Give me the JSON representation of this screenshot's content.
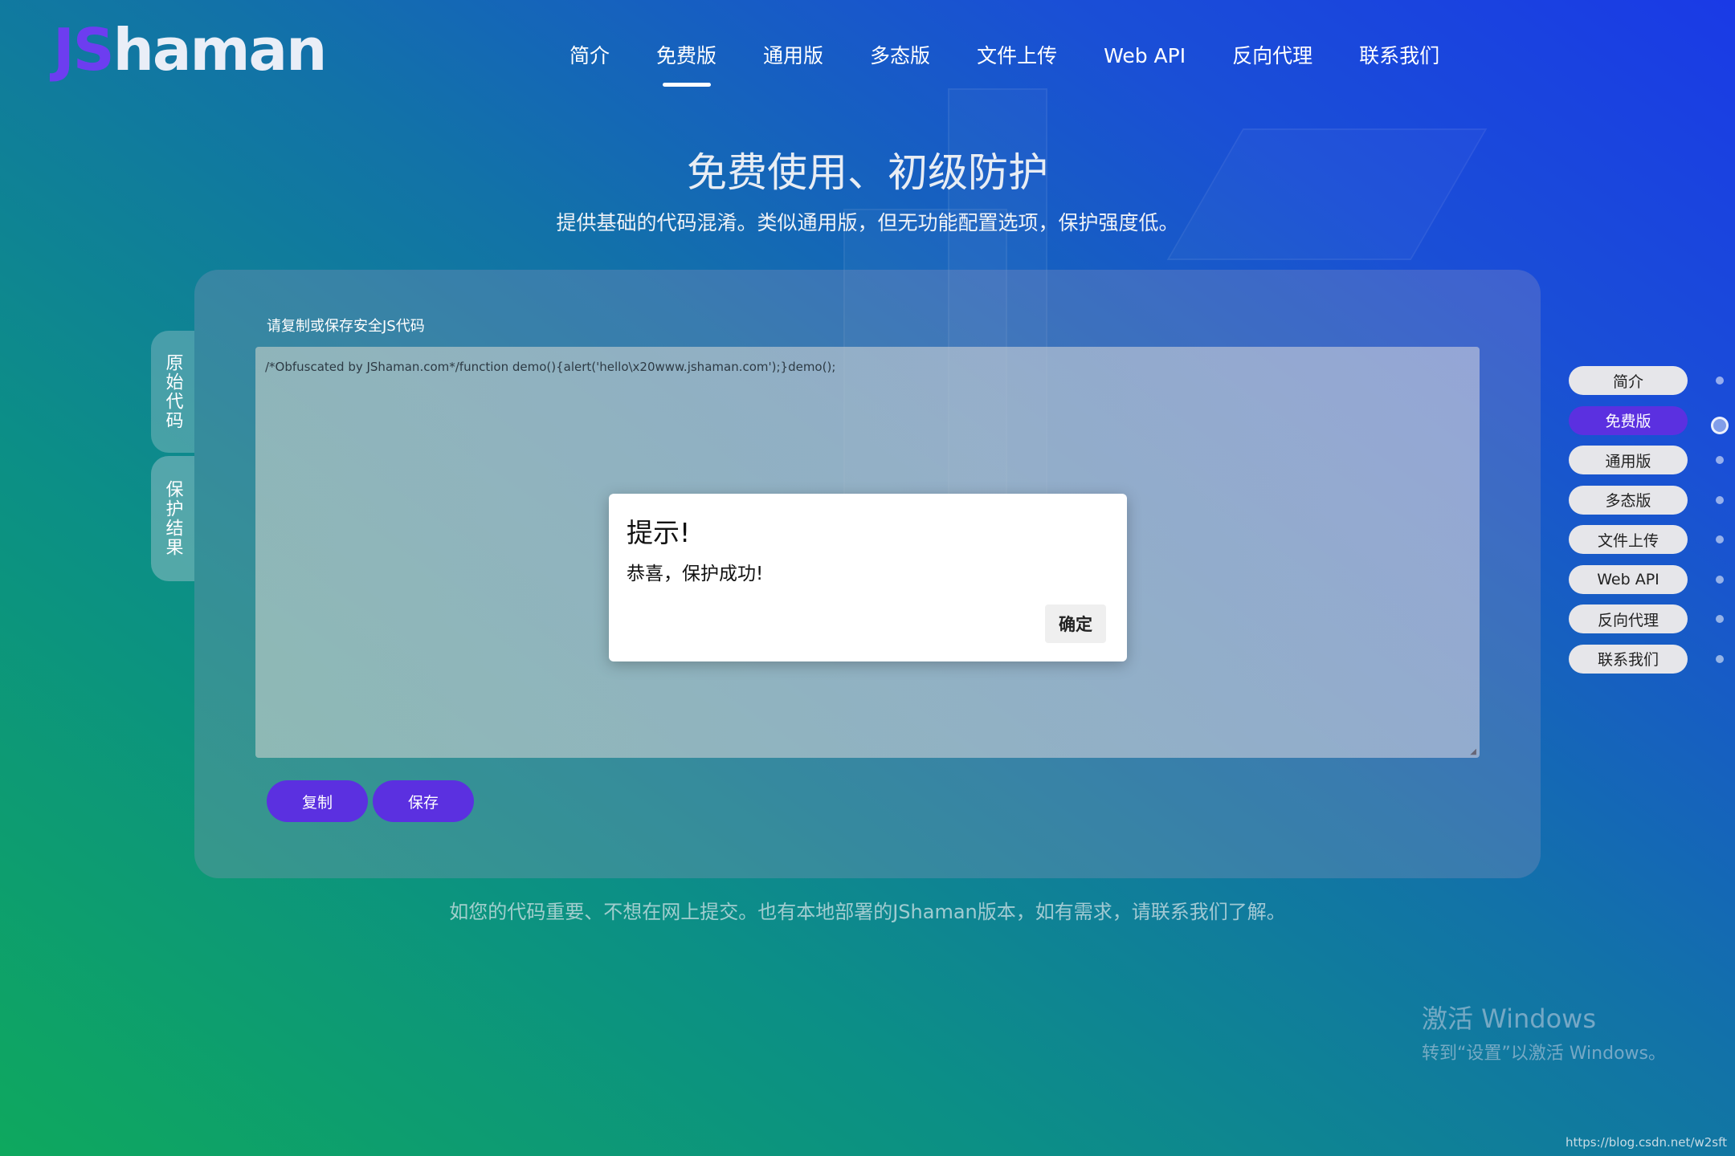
{
  "logo": {
    "js": "JS",
    "rest": "haman"
  },
  "top_nav": [
    {
      "label": "简介"
    },
    {
      "label": "免费版",
      "active": true
    },
    {
      "label": "通用版"
    },
    {
      "label": "多态版"
    },
    {
      "label": "文件上传"
    },
    {
      "label": "Web API"
    },
    {
      "label": "反向代理"
    },
    {
      "label": "联系我们"
    }
  ],
  "hero": {
    "title": "免费使用、初级防护",
    "subtitle": "提供基础的代码混淆。类似通用版，但无功能配置选项，保护强度低。"
  },
  "side_tabs": {
    "original": "原始代码",
    "result": "保护结果"
  },
  "editor": {
    "label": "请复制或保存安全JS代码",
    "code": "/*Obfuscated by JShaman.com*/function demo(){alert('hello\\x20www.jshaman.com');}demo();"
  },
  "buttons": {
    "copy": "复制",
    "save": "保存"
  },
  "footer_note": "如您的代码重要、不想在网上提交。也有本地部署的JShaman版本，如有需求，请联系我们了解。",
  "dialog": {
    "title": "提示!",
    "message": "恭喜，保护成功!",
    "ok": "确定"
  },
  "right_nav": [
    {
      "label": "简介"
    },
    {
      "label": "免费版",
      "active": true
    },
    {
      "label": "通用版"
    },
    {
      "label": "多态版"
    },
    {
      "label": "文件上传"
    },
    {
      "label": "Web API"
    },
    {
      "label": "反向代理"
    },
    {
      "label": "联系我们"
    }
  ],
  "watermark": {
    "line1": "激活 Windows",
    "line2": "转到“设置”以激活 Windows。"
  },
  "blog_url": "https://blog.csdn.net/w2sft",
  "colors": {
    "accent": "#5b30e0",
    "logo_js": "#6d3df0"
  }
}
